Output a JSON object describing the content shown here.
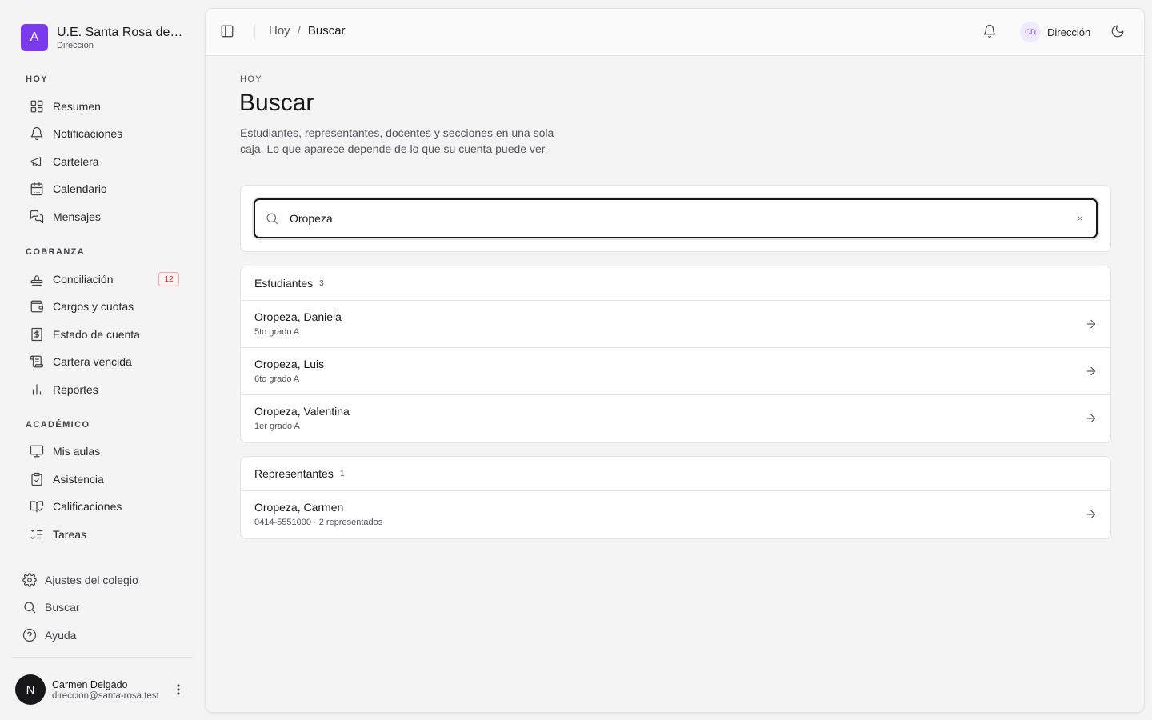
{
  "sidebar": {
    "brand": {
      "initial": "A",
      "name": "U.E. Santa Rosa de Lima",
      "role": "Dirección",
      "accent": "#7c3aed"
    },
    "sections": [
      {
        "title": "HOY",
        "items": [
          {
            "label": "Resumen",
            "icon": "grid-icon"
          },
          {
            "label": "Notificaciones",
            "icon": "bell-icon"
          },
          {
            "label": "Cartelera",
            "icon": "megaphone-icon"
          },
          {
            "label": "Calendario",
            "icon": "calendar-icon"
          },
          {
            "label": "Mensajes",
            "icon": "messages-icon"
          }
        ]
      },
      {
        "title": "COBRANZA",
        "items": [
          {
            "label": "Conciliación",
            "icon": "stamp-icon",
            "badge": "12"
          },
          {
            "label": "Cargos y cuotas",
            "icon": "wallet-icon"
          },
          {
            "label": "Estado de cuenta",
            "icon": "receipt-dollar-icon"
          },
          {
            "label": "Cartera vencida",
            "icon": "scroll-icon"
          },
          {
            "label": "Reportes",
            "icon": "bar-chart-icon"
          }
        ]
      },
      {
        "title": "ACADÉMICO",
        "items": [
          {
            "label": "Mis aulas",
            "icon": "presentation-icon"
          },
          {
            "label": "Asistencia",
            "icon": "clipboard-check-icon"
          },
          {
            "label": "Calificaciones",
            "icon": "book-check-icon"
          },
          {
            "label": "Tareas",
            "icon": "list-checks-icon"
          }
        ]
      }
    ],
    "footer": [
      {
        "label": "Ajustes del colegio",
        "icon": "gear-icon"
      },
      {
        "label": "Buscar",
        "icon": "search-icon"
      },
      {
        "label": "Ayuda",
        "icon": "help-circle-icon"
      }
    ],
    "user": {
      "initial": "N",
      "name": "Carmen Delgado",
      "email": "direccion@santa-rosa.test"
    }
  },
  "topbar": {
    "breadcrumb": {
      "parent": "Hoy",
      "separator": "/",
      "current": "Buscar"
    },
    "account": {
      "initials": "CD",
      "label": "Dirección"
    }
  },
  "page": {
    "eyebrow": "HOY",
    "title": "Buscar",
    "description": "Estudiantes, representantes, docentes y secciones en una sola caja. Lo que aparece depende de lo que su cuenta puede ver."
  },
  "search": {
    "value": "Oropeza",
    "placeholder": ""
  },
  "results": {
    "students": {
      "title": "Estudiantes",
      "count": "3",
      "rows": [
        {
          "name": "Oropeza, Daniela",
          "sub": "5to grado A"
        },
        {
          "name": "Oropeza, Luis",
          "sub": "6to grado A"
        },
        {
          "name": "Oropeza, Valentina",
          "sub": "1er grado A"
        }
      ]
    },
    "guardians": {
      "title": "Representantes",
      "count": "1",
      "rows": [
        {
          "name": "Oropeza, Carmen",
          "sub": "0414-5551000 · 2 representados"
        }
      ]
    }
  }
}
